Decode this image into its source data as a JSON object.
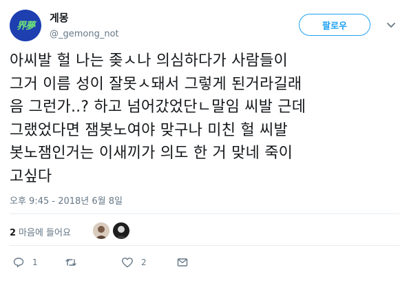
{
  "user": {
    "avatar_text": "界夢",
    "display_name": "게몽",
    "handle": "@_gemong_not"
  },
  "follow_button_label": "팔로우",
  "tweet": {
    "lines": [
      "아씨발 헐 나는 좆ㅅ나 의심하다가 사람들이",
      "그거 이름 성이 잘못ㅅ돼서 그렇게 된거라길래",
      "음 그런가..? 하고 넘어갔었단ㄴ말임 씨발 근데",
      "그랬었다면 잼봇노여야 맞구나 미친 헐 씨발",
      "봇노잼인거는 이새끼가 의도 한 거 맞네 죽이",
      "고싶다"
    ]
  },
  "timestamp": "오후 9:45 - 2018년 6월 8일",
  "likes": {
    "count": "2",
    "label": "마음에 들어요"
  },
  "actions": {
    "reply_count": "1",
    "retweet_count": "",
    "like_count": "2"
  },
  "colors": {
    "accent": "#1da1f2",
    "secondary_text": "#657786",
    "divider": "#e6ecf0",
    "avatar_bg": "#1d3fb0",
    "avatar_text": "#6ee07a"
  }
}
